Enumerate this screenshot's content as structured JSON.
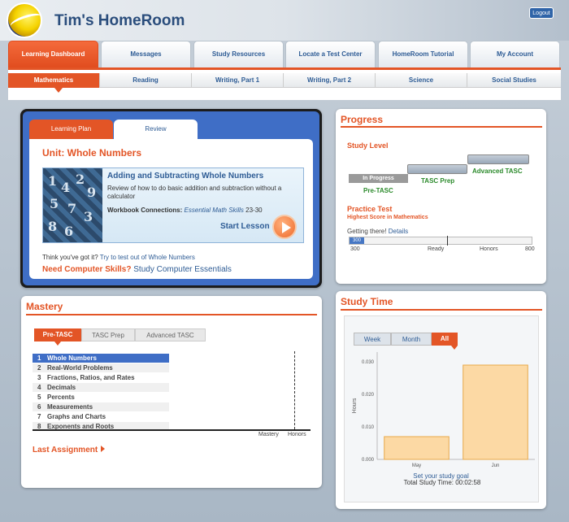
{
  "header": {
    "title": "Tim's HomeRoom",
    "logout_label": "Logout"
  },
  "nav": {
    "tabs": [
      "Learning Dashboard",
      "Messages",
      "Study Resources",
      "Locate a Test Center",
      "HomeRoom Tutorial",
      "My Account"
    ],
    "subtabs": [
      "Mathematics",
      "Reading",
      "Writing, Part 1",
      "Writing, Part 2",
      "Science",
      "Social Studies"
    ]
  },
  "learning_plan": {
    "tab_plan": "Learning Plan",
    "tab_review": "Review",
    "unit_title": "Unit: Whole Numbers",
    "lesson_title": "Adding and Subtracting Whole Numbers",
    "lesson_desc": "Review of how to do basic addition and subtraction without a calculator",
    "workbook_label": "Workbook Connections:",
    "workbook_book": "Essential Math Skills",
    "workbook_pages": "23-30",
    "start_label": "Start Lesson",
    "test_out_prefix": "Think you've got it?",
    "test_out_link": "Try to test out of Whole Numbers",
    "comp_prefix": "Need Computer Skills?",
    "comp_link": "Study Computer Essentials"
  },
  "progress": {
    "title": "Progress",
    "study_level": "Study Level",
    "in_progress": "In Progress",
    "levels": [
      "Pre-TASC",
      "TASC Prep",
      "Advanced TASC"
    ],
    "practice_test": "Practice Test",
    "highest_score": "Highest Score in Mathematics",
    "getting_there": "Getting there!",
    "details_link": "Details",
    "score_value": "300",
    "tick_labels": [
      "300",
      "Ready",
      "Honors",
      "800"
    ]
  },
  "mastery": {
    "title": "Mastery",
    "tabs": [
      "Pre-TASC",
      "TASC Prep",
      "Advanced TASC"
    ],
    "rows": [
      {
        "num": "1",
        "label": "Whole Numbers"
      },
      {
        "num": "2",
        "label": "Real-World Problems"
      },
      {
        "num": "3",
        "label": "Fractions, Ratios, and Rates"
      },
      {
        "num": "4",
        "label": "Decimals"
      },
      {
        "num": "5",
        "label": "Percents"
      },
      {
        "num": "6",
        "label": "Measurements"
      },
      {
        "num": "7",
        "label": "Graphs and Charts"
      },
      {
        "num": "8",
        "label": "Exponents and Roots"
      }
    ],
    "axis_labels": [
      "Mastery",
      "Honors"
    ],
    "last_assignment": "Last Assignment"
  },
  "study_time": {
    "title": "Study Time",
    "tabs": [
      "Week",
      "Month",
      "All"
    ],
    "total_label": "Total Study Time: 00:02:58",
    "goal_link": "Set your study goal"
  },
  "chart_data": {
    "type": "bar",
    "categories": [
      "May",
      "Jun"
    ],
    "values": [
      0.007,
      0.029
    ],
    "ylabel": "Hours",
    "ylim": [
      0,
      0.033
    ],
    "yticks": [
      "0.000",
      "0.010",
      "0.020",
      "0.030"
    ],
    "color": "#fcd9a4"
  }
}
